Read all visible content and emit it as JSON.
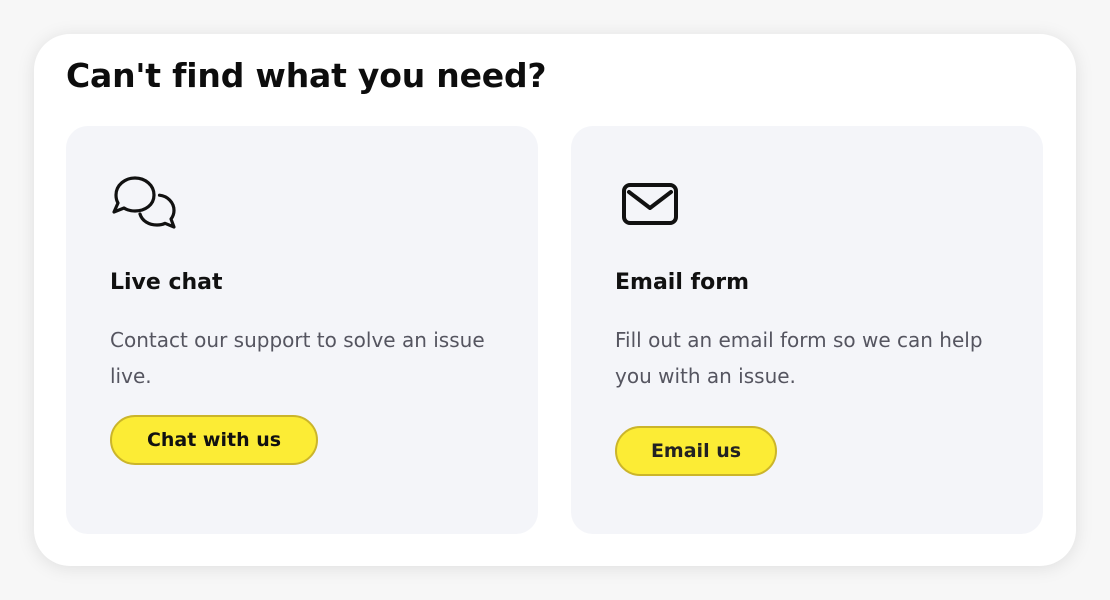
{
  "section": {
    "title": "Can't find what you need?"
  },
  "cards": [
    {
      "icon": "chat-bubbles-icon",
      "title": "Live chat",
      "description": "Contact our support to solve an issue live.",
      "button_label": "Chat with us"
    },
    {
      "icon": "envelope-icon",
      "title": "Email form",
      "description": "Fill out an email form so we can help you with an issue.",
      "button_label": "Email us"
    }
  ],
  "colors": {
    "button_fill": "#fcec35",
    "button_border": "#cbb52a",
    "card_background": "#f4f5f9",
    "body_text": "#555560"
  }
}
